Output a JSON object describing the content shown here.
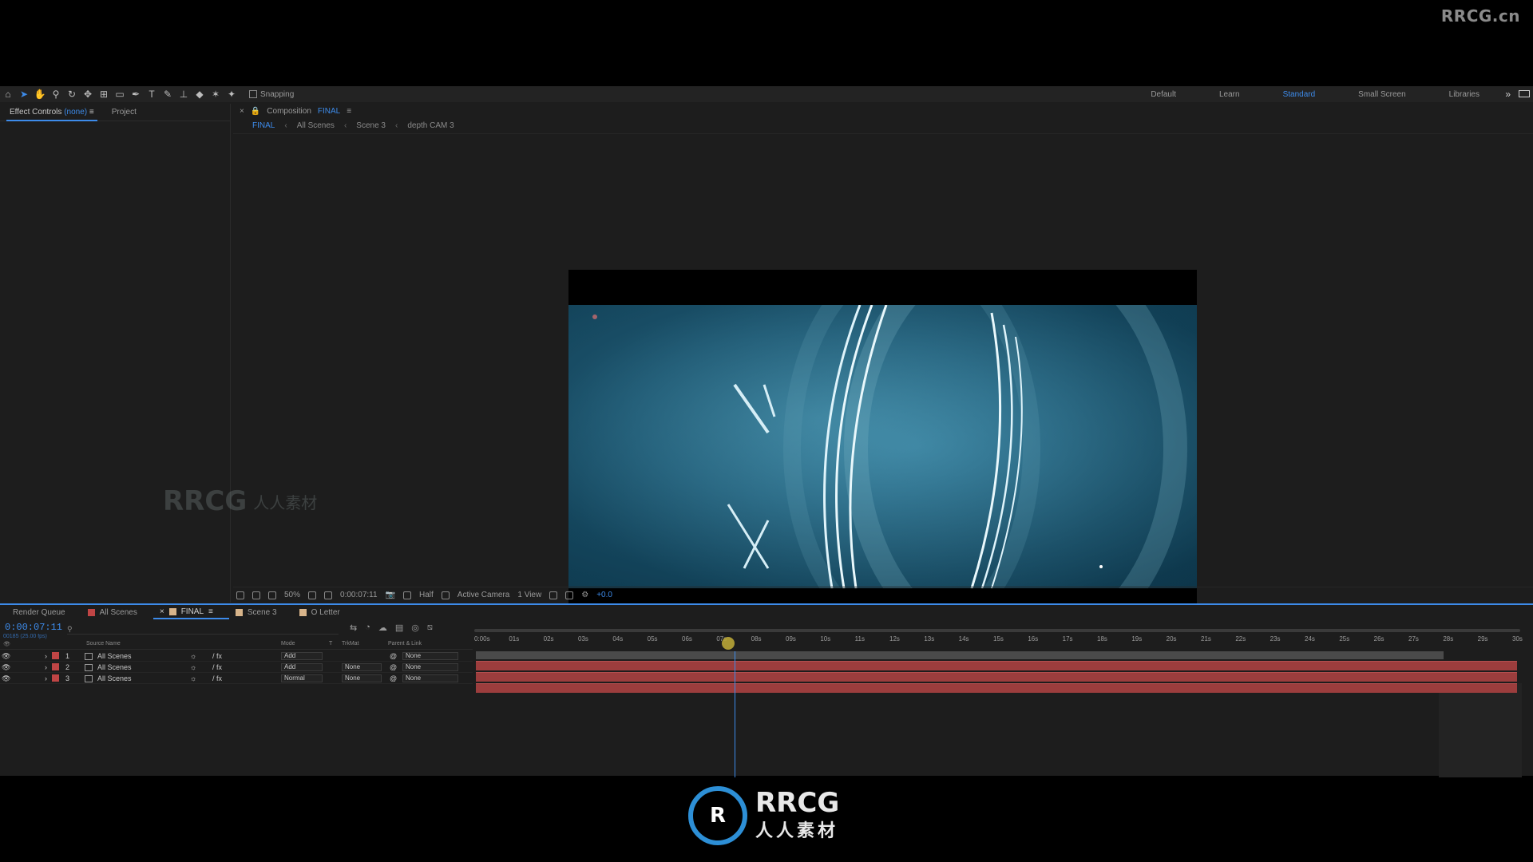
{
  "watermark_top": "RRCG.cn",
  "toolbar": {
    "snapping_label": "Snapping",
    "workspaces": [
      "Default",
      "Learn",
      "Standard",
      "Small Screen",
      "Libraries"
    ],
    "active_workspace": "Standard"
  },
  "left_panel": {
    "effect_controls_label": "Effect Controls",
    "effect_controls_target": "(none)",
    "project_label": "Project"
  },
  "composition": {
    "tab_prefix": "Composition",
    "tab_name": "FINAL",
    "breadcrumbs": [
      "FINAL",
      "All Scenes",
      "Scene 3",
      "depth CAM 3"
    ]
  },
  "viewer_footer": {
    "zoom": "50%",
    "timecode": "0:00:07:11",
    "resolution": "Half",
    "camera": "Active Camera",
    "views": "1 View",
    "exposure": "+0.0"
  },
  "timeline": {
    "tabs": [
      {
        "label": "Render Queue",
        "color": ""
      },
      {
        "label": "All Scenes",
        "color": "#c04545"
      },
      {
        "label": "FINAL",
        "color": "#d8b48a",
        "active": true
      },
      {
        "label": "Scene 3",
        "color": "#d8b48a"
      },
      {
        "label": "O Letter",
        "color": "#d8b48a"
      }
    ],
    "current_time": "0:00:07:11",
    "fps": "00185 (25.00 fps)",
    "search_placeholder": "",
    "columns": [
      "Source Name",
      "Mode",
      "T",
      "TrkMat",
      "Parent & Link"
    ],
    "layers": [
      {
        "index": "1",
        "name": "All Scenes",
        "mode": "Add",
        "trkmat": "",
        "parent": "None"
      },
      {
        "index": "2",
        "name": "All Scenes",
        "mode": "Add",
        "trkmat": "None",
        "parent": "None"
      },
      {
        "index": "3",
        "name": "All Scenes",
        "mode": "Normal",
        "trkmat": "None",
        "parent": "None"
      }
    ],
    "ruler_ticks": [
      "0:00s",
      "01s",
      "02s",
      "03s",
      "04s",
      "05s",
      "06s",
      "07s",
      "08s",
      "09s",
      "10s",
      "11s",
      "12s",
      "13s",
      "14s",
      "15s",
      "16s",
      "17s",
      "18s",
      "19s",
      "20s",
      "21s",
      "22s",
      "23s",
      "24s",
      "25s",
      "26s",
      "27s",
      "28s",
      "29s",
      "30s"
    ]
  },
  "watermark_mid": {
    "brand": "RRCG",
    "sub": "人人素材"
  },
  "watermark_bottom": {
    "brand": "RRCG",
    "sub": "人人素材"
  },
  "colors": {
    "accent": "#3d8bea",
    "layer_bar": "#9c3d3d",
    "layer_label": "#c04545"
  }
}
